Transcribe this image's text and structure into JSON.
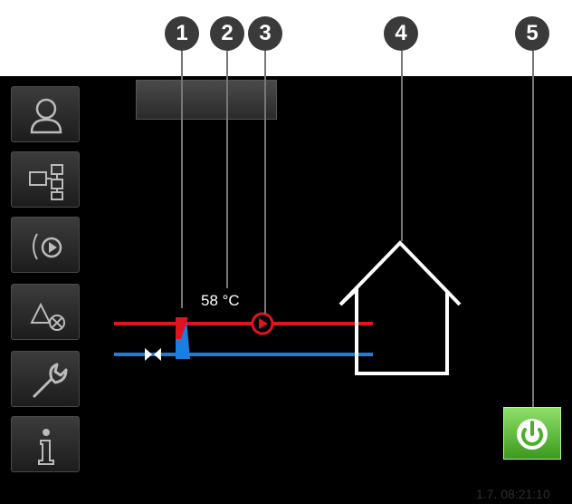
{
  "callouts": [
    "1",
    "2",
    "3",
    "4",
    "5"
  ],
  "temperature": "58 °C",
  "clock": "1.7. 08:21:10",
  "sidebar": {
    "items": [
      {
        "name": "user-menu",
        "icon": "person-icon"
      },
      {
        "name": "system-overview",
        "icon": "system-diagram-icon"
      },
      {
        "name": "heating-circuit",
        "icon": "pump-icon"
      },
      {
        "name": "alarms",
        "icon": "alarm-icon"
      },
      {
        "name": "service",
        "icon": "wrench-icon"
      },
      {
        "name": "info",
        "icon": "info-icon"
      }
    ]
  },
  "colors": {
    "supply": "#e0141e",
    "return": "#1a7fe0",
    "power_button": "#4caf2a"
  }
}
